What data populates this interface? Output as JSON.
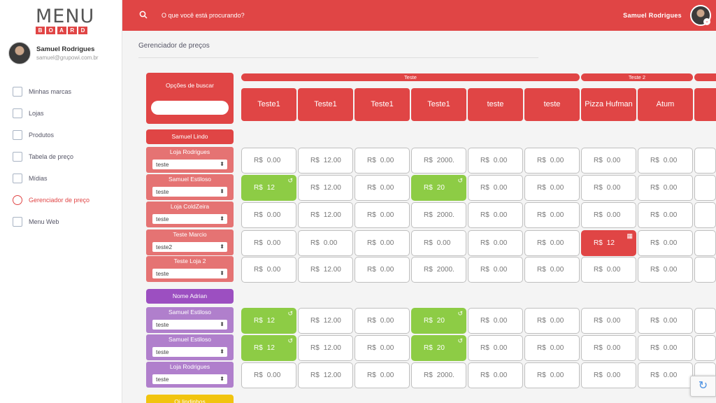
{
  "logo": {
    "top": "MENU",
    "bottom": [
      "B",
      "O",
      "A",
      "R",
      "D"
    ]
  },
  "user": {
    "name": "Samuel Rodrigues",
    "email": "samuel@grupowi.com.br"
  },
  "nav": [
    {
      "label": "Minhas marcas",
      "icon": "grid-icon"
    },
    {
      "label": "Lojas",
      "icon": "store-icon"
    },
    {
      "label": "Produtos",
      "icon": "utensils-icon"
    },
    {
      "label": "Tabela de preço",
      "icon": "table-icon"
    },
    {
      "label": "Mídias",
      "icon": "play-icon"
    },
    {
      "label": "Gerenciador de preço",
      "icon": "price-manager-icon",
      "active": true
    },
    {
      "label": "Menu Web",
      "icon": "copy-icon"
    }
  ],
  "topbar": {
    "search_placeholder": "O que você está procurando?",
    "user_name": "Samuel Rodrigues"
  },
  "page_title": "Gerenciador de preços",
  "search_options": {
    "label": "Opções de buscar",
    "input_value": ""
  },
  "groups": [
    {
      "label": "Teste"
    },
    {
      "label": "Teste 2"
    }
  ],
  "products": [
    "Teste1",
    "Teste1",
    "Teste1",
    "Teste1",
    "teste",
    "teste",
    "Pizza Hufman",
    "Atum"
  ],
  "currency": "R$",
  "persons": [
    {
      "label": "Samuel Lindo",
      "color": "#e04545"
    },
    {
      "label": "Nome Adrian",
      "color": "#9c4fc1"
    },
    {
      "label": "Oi lindinhos",
      "color": "#f1c40f"
    }
  ],
  "colors": {
    "accent": "#e04545",
    "red_store": "#e57373",
    "purple_store": "#b07fcc",
    "green": "#8dcc45"
  },
  "rows": [
    {
      "store": "Loja Rodrigues",
      "select": "teste",
      "values": [
        "0.00",
        "12.00",
        "0.00",
        "2000.",
        "0.00",
        "0.00",
        "0.00",
        "0.00"
      ],
      "states": [
        "",
        "",
        "",
        "",
        "",
        "",
        "",
        ""
      ]
    },
    {
      "store": "Samuel Estiloso",
      "select": "teste",
      "values": [
        "12",
        "12.00",
        "0.00",
        "20",
        "0.00",
        "0.00",
        "0.00",
        "0.00"
      ],
      "states": [
        "green",
        "",
        "",
        "green",
        "",
        "",
        "",
        ""
      ]
    },
    {
      "store": "Loja ColdZeira",
      "select": "teste",
      "values": [
        "0.00",
        "12.00",
        "0.00",
        "2000.",
        "0.00",
        "0.00",
        "0.00",
        "0.00"
      ],
      "states": [
        "",
        "",
        "",
        "",
        "",
        "",
        "",
        ""
      ]
    },
    {
      "store": "Teste Marcio",
      "select": "teste2",
      "values": [
        "0.00",
        "0.00",
        "0.00",
        "0.00",
        "0.00",
        "0.00",
        "12",
        "0.00"
      ],
      "states": [
        "",
        "",
        "",
        "",
        "",
        "",
        "red",
        ""
      ]
    },
    {
      "store": "Teste Loja 2",
      "select": "teste",
      "values": [
        "0.00",
        "12.00",
        "0.00",
        "2000.",
        "0.00",
        "0.00",
        "0.00",
        "0.00"
      ],
      "states": [
        "",
        "",
        "",
        "",
        "",
        "",
        "",
        ""
      ]
    },
    {
      "store": "Samuel Estiloso",
      "select": "teste",
      "values": [
        "12",
        "12.00",
        "0.00",
        "20",
        "0.00",
        "0.00",
        "0.00",
        "0.00"
      ],
      "states": [
        "green",
        "",
        "",
        "green",
        "",
        "",
        "",
        ""
      ]
    },
    {
      "store": "Samuel Estiloso",
      "select": "teste",
      "values": [
        "12",
        "12.00",
        "0.00",
        "20",
        "0.00",
        "0.00",
        "0.00",
        "0.00"
      ],
      "states": [
        "green",
        "",
        "",
        "green",
        "",
        "",
        "",
        ""
      ]
    },
    {
      "store": "Loja Rodrigues",
      "select": "teste",
      "values": [
        "0.00",
        "12.00",
        "0.00",
        "2000.",
        "0.00",
        "0.00",
        "0.00",
        "0.00"
      ],
      "states": [
        "",
        "",
        "",
        "",
        "",
        "",
        "",
        ""
      ]
    }
  ]
}
